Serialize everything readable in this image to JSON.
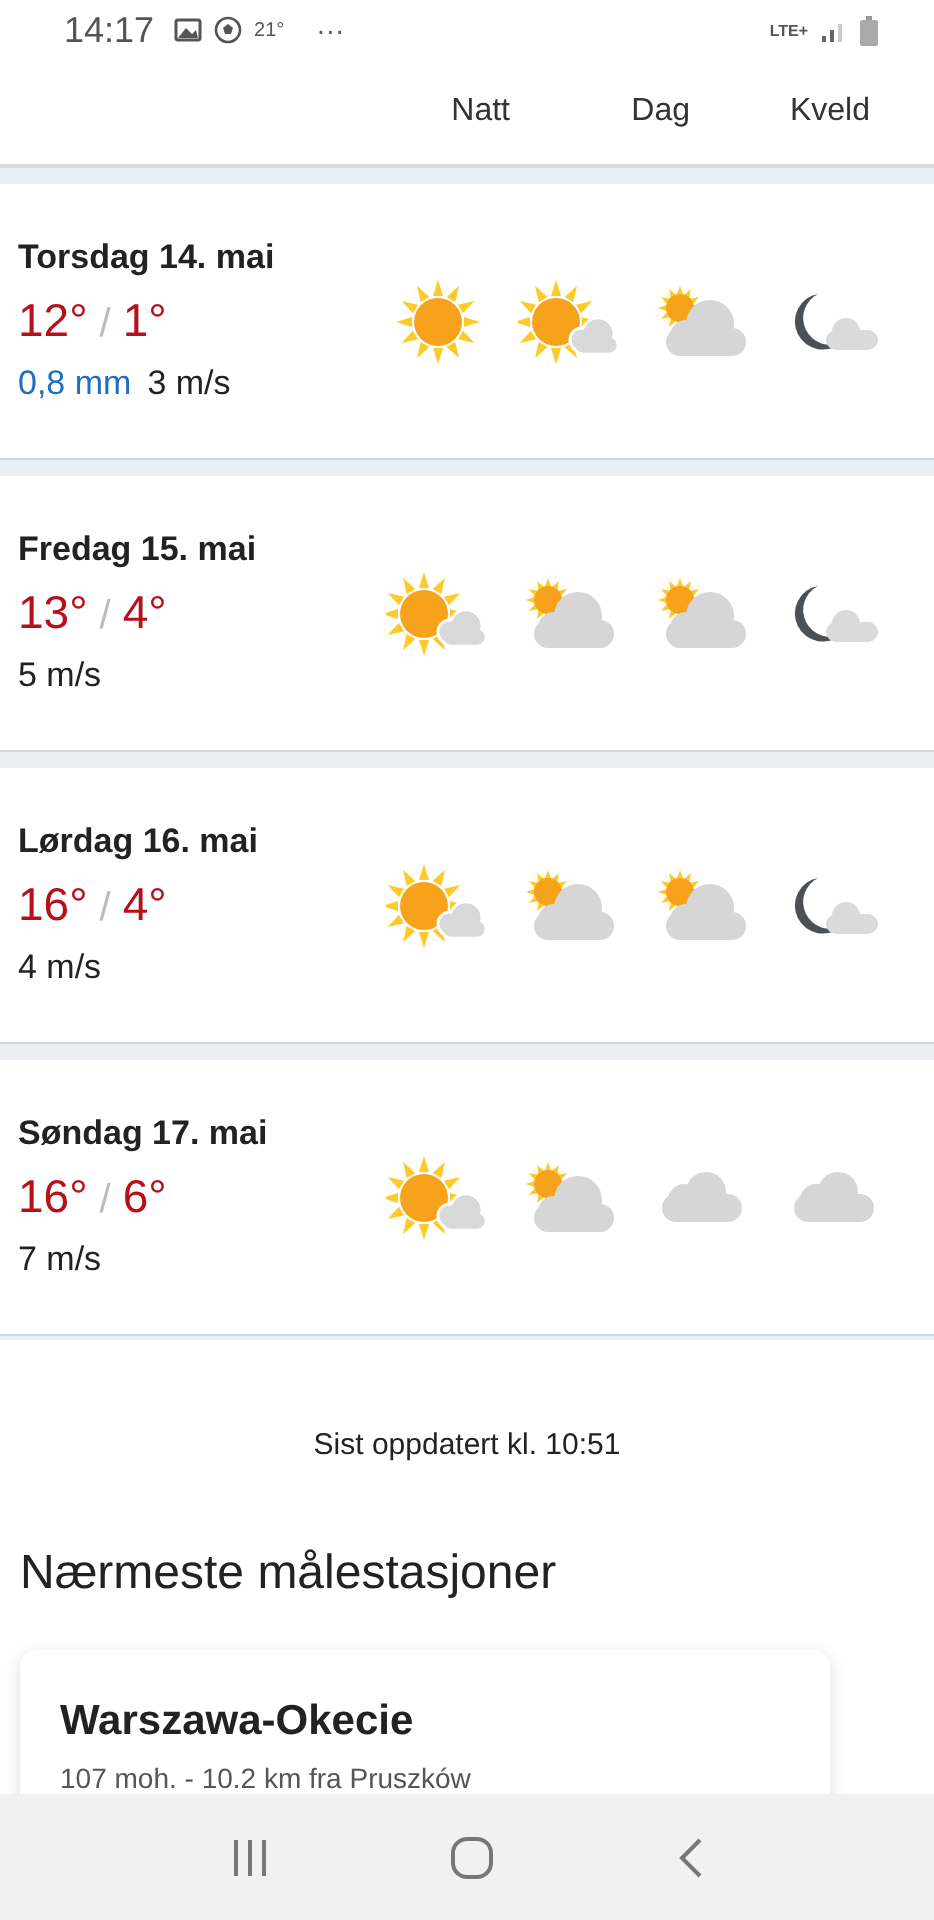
{
  "status_bar": {
    "time": "14:17",
    "temperature": "21°",
    "more": "···",
    "network": "LTE+"
  },
  "header": {
    "columns": [
      "Natt",
      "Dag",
      "Kveld"
    ]
  },
  "days": [
    {
      "date": "Torsdag 14. mai",
      "high": "12°",
      "separator": "/",
      "low": "1°",
      "precip": "0,8 mm",
      "wind": "3 m/s",
      "icons": [
        {
          "kind": "sun"
        },
        {
          "kind": "sun-cloud"
        },
        {
          "kind": "cloud-sun"
        },
        {
          "kind": "moon-cloud"
        }
      ]
    },
    {
      "date": "Fredag 15. mai",
      "high": "13°",
      "separator": "/",
      "low": "4°",
      "wind": "5 m/s",
      "icons": [
        {
          "kind": "sun-cloud"
        },
        {
          "kind": "cloud-sun"
        },
        {
          "kind": "cloud-sun"
        },
        {
          "kind": "moon-cloud"
        }
      ]
    },
    {
      "date": "Lørdag 16. mai",
      "high": "16°",
      "separator": "/",
      "low": "4°",
      "wind": "4 m/s",
      "icons": [
        {
          "kind": "sun-cloud"
        },
        {
          "kind": "cloud-sun"
        },
        {
          "kind": "cloud-sun"
        },
        {
          "kind": "moon-cloud"
        }
      ]
    },
    {
      "date": "Søndag 17. mai",
      "high": "16°",
      "separator": "/",
      "low": "6°",
      "wind": "7 m/s",
      "icons": [
        {
          "kind": "sun-cloud"
        },
        {
          "kind": "cloud-sun"
        },
        {
          "kind": "cloud"
        },
        {
          "kind": "cloud"
        }
      ]
    }
  ],
  "updated": "Sist oppdatert kl. 10:51",
  "stations": {
    "title": "Nærmeste målestasjoner",
    "items": [
      {
        "name": "Warszawa-Okecie",
        "detail": "107 moh. - 10.2 km fra Pruszków"
      }
    ]
  }
}
